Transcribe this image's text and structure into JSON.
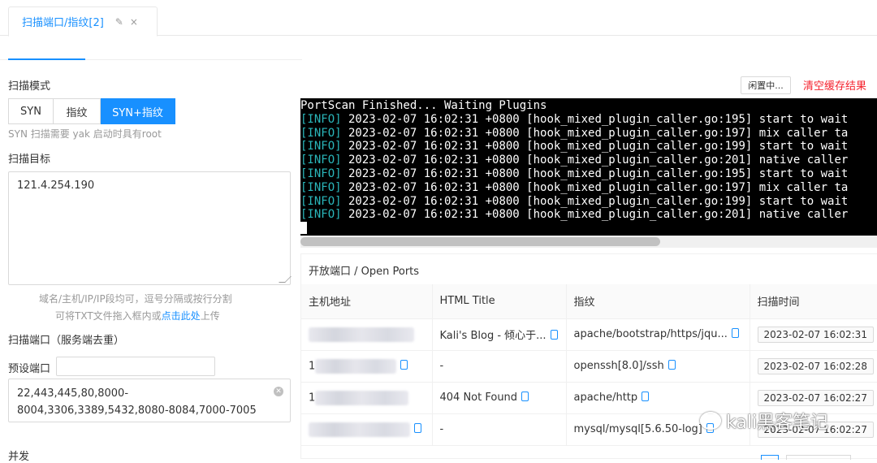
{
  "tab": {
    "title": "扫描端口/指纹[2]",
    "edit_icon": "✎",
    "close_icon": "×"
  },
  "form": {
    "mode_label": "扫描模式",
    "modes": [
      "SYN",
      "指纹",
      "SYN+指纹"
    ],
    "selected_mode": "SYN+指纹",
    "syn_hint": "SYN 扫描需要 yak 启动时具有root",
    "target_label": "扫描目标",
    "target_value": "121.4.254.190",
    "target_hint1": "域名/主机/IP/IP段均可，逗号分隔或按行分割",
    "target_hint2_pre": "可将TXT文件拖入框内或",
    "target_hint2_link": "点击此处",
    "target_hint2_post": "上传",
    "ports_label": "扫描端口（服务端去重）",
    "preset_label": "预设端口",
    "preset_value": "",
    "ports_value": "22,443,445,80,8000-8004,3306,3389,5432,8080-8084,7000-7005",
    "concurrency_label": "并发"
  },
  "actions": {
    "idle_label": "闲置中...",
    "clear_label": "清空缓存结果"
  },
  "terminal": {
    "first_line": "PortScan Finished... Waiting Plugins",
    "lines": [
      {
        "tag": "[INFO]",
        "text": " 2023-02-07 16:02:31 +0800 [hook_mixed_plugin_caller.go:195] start to wait"
      },
      {
        "tag": "[INFO]",
        "text": " 2023-02-07 16:02:31 +0800 [hook_mixed_plugin_caller.go:197] mix caller ta"
      },
      {
        "tag": "[INFO]",
        "text": " 2023-02-07 16:02:31 +0800 [hook_mixed_plugin_caller.go:199] start to wait"
      },
      {
        "tag": "[INFO]",
        "text": " 2023-02-07 16:02:31 +0800 [hook_mixed_plugin_caller.go:201] native caller"
      },
      {
        "tag": "[INFO]",
        "text": " 2023-02-07 16:02:31 +0800 [hook_mixed_plugin_caller.go:195] start to wait"
      },
      {
        "tag": "[INFO]",
        "text": " 2023-02-07 16:02:31 +0800 [hook_mixed_plugin_caller.go:197] mix caller ta"
      },
      {
        "tag": "[INFO]",
        "text": " 2023-02-07 16:02:31 +0800 [hook_mixed_plugin_caller.go:199] start to wait"
      },
      {
        "tag": "[INFO]",
        "text": " 2023-02-07 16:02:31 +0800 [hook_mixed_plugin_caller.go:201] native caller"
      }
    ]
  },
  "ports_table": {
    "title": "开放端口 / Open Ports",
    "columns": [
      "主机地址",
      "HTML Title",
      "指纹",
      "扫描时间"
    ],
    "rows": [
      {
        "host": "",
        "title": "Kali's Blog - 倾心于...",
        "fingerprint": "apache/bootstrap/https/jqu...",
        "time": "2023-02-07 16:02:31"
      },
      {
        "host": "1",
        "title": "-",
        "fingerprint": "openssh[8.0]/ssh",
        "time": "2023-02-07 16:02:28"
      },
      {
        "host": "1",
        "title": "404 Not Found",
        "fingerprint": "apache/http",
        "time": "2023-02-07 16:02:27"
      },
      {
        "host": "",
        "title": "-",
        "fingerprint": "mysql/mysql[5.6.50-log]",
        "time": "2023-02-07 16:02:27"
      }
    ]
  },
  "watermark": "kali黑客笔记"
}
